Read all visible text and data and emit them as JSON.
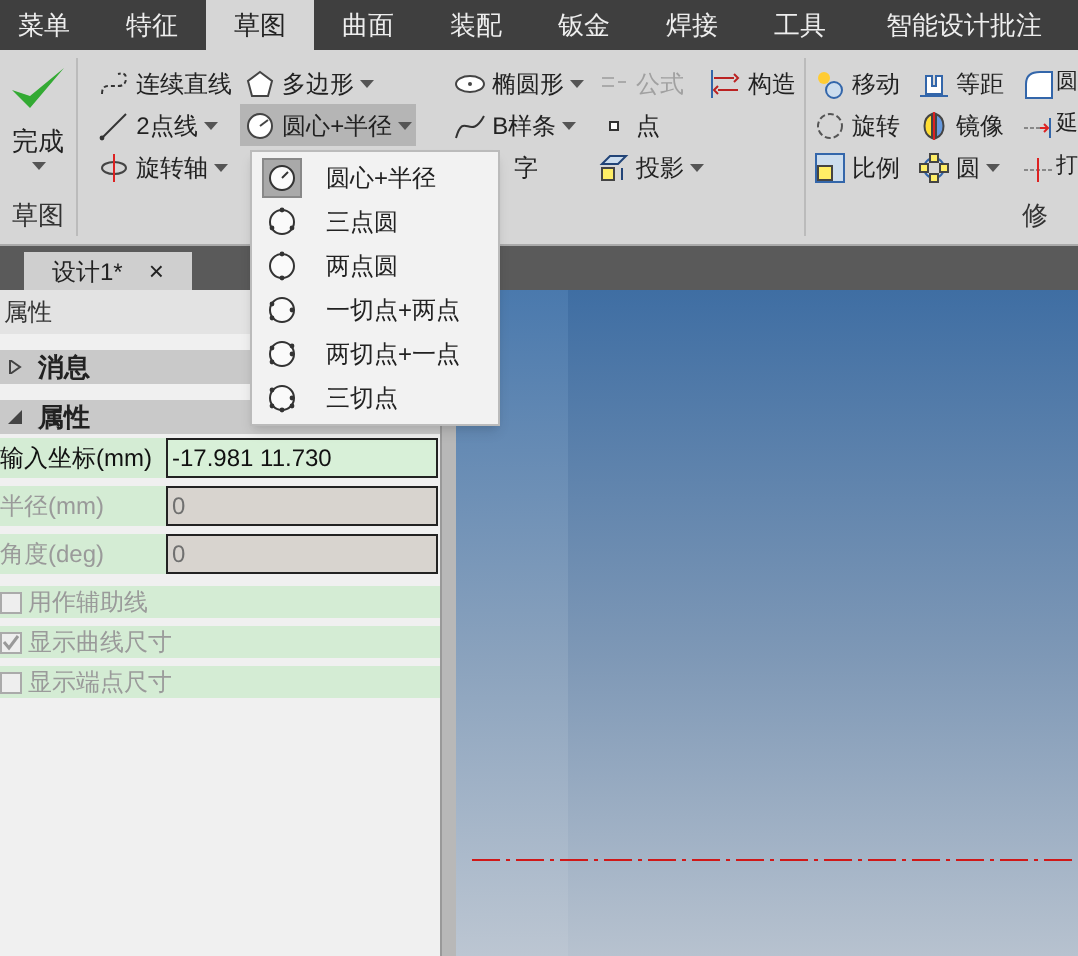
{
  "menu_tabs": [
    {
      "label": "菜单",
      "selected": false
    },
    {
      "label": "特征",
      "selected": false
    },
    {
      "label": "草图",
      "selected": true
    },
    {
      "label": "曲面",
      "selected": false
    },
    {
      "label": "装配",
      "selected": false
    },
    {
      "label": "钣金",
      "selected": false
    },
    {
      "label": "焊接",
      "selected": false
    },
    {
      "label": "工具",
      "selected": false
    },
    {
      "label": "智能设计批注",
      "selected": false
    }
  ],
  "ribbon": {
    "finish_button": {
      "label": "完成"
    },
    "sketch_group": {
      "label": "草图",
      "columns": [
        [
          {
            "label": "连续直线",
            "dropdown": false,
            "disabled": false,
            "active": false
          },
          {
            "label": "2点线",
            "dropdown": true,
            "disabled": false,
            "active": false
          },
          {
            "label": "旋转轴",
            "dropdown": true,
            "disabled": false,
            "active": false
          }
        ],
        [
          {
            "label": "多边形",
            "dropdown": true,
            "disabled": false,
            "active": false
          },
          {
            "label": "圆心+半径",
            "dropdown": true,
            "disabled": false,
            "active": true
          }
        ],
        [
          {
            "label": "椭圆形",
            "dropdown": true,
            "disabled": false,
            "active": false
          },
          {
            "label": "B样条",
            "dropdown": true,
            "disabled": false,
            "active": false
          },
          {
            "label": "字",
            "dropdown": false,
            "disabled": false,
            "active": false
          }
        ],
        [
          {
            "label": "公式",
            "dropdown": false,
            "disabled": true,
            "active": false
          },
          {
            "label": "点",
            "dropdown": false,
            "disabled": false,
            "active": false
          },
          {
            "label": "投影",
            "dropdown": true,
            "disabled": false,
            "active": false
          }
        ],
        [
          {
            "label": "构造",
            "dropdown": false,
            "disabled": false,
            "active": false
          }
        ]
      ]
    },
    "modify_group": {
      "label": "修",
      "columns": [
        [
          {
            "label": "移动",
            "dropdown": false,
            "disabled": false,
            "active": false
          },
          {
            "label": "旋转",
            "dropdown": false,
            "disabled": false,
            "active": false
          },
          {
            "label": "比例",
            "dropdown": false,
            "disabled": false,
            "active": false
          }
        ],
        [
          {
            "label": "等距",
            "dropdown": false,
            "disabled": false,
            "active": false
          },
          {
            "label": "镜像",
            "dropdown": false,
            "disabled": false,
            "active": false
          },
          {
            "label": "圆",
            "dropdown": true,
            "disabled": false,
            "active": false
          }
        ],
        [
          {
            "label": "圆",
            "disabled": false,
            "active": false
          },
          {
            "label": "延",
            "disabled": false,
            "active": false
          },
          {
            "label": "打",
            "disabled": false,
            "active": false
          }
        ]
      ]
    }
  },
  "dropdown_menu": {
    "items": [
      {
        "label": "圆心+半径",
        "selected": true
      },
      {
        "label": "三点圆",
        "selected": false
      },
      {
        "label": "两点圆",
        "selected": false
      },
      {
        "label": "一切点+两点",
        "selected": false
      },
      {
        "label": "两切点+一点",
        "selected": false
      },
      {
        "label": "三切点",
        "selected": false
      }
    ]
  },
  "document_tab": {
    "title": "设计1*",
    "close": "×"
  },
  "panel": {
    "title": "属性",
    "sections": [
      {
        "label": "消息",
        "expanded": false
      },
      {
        "label": "属性",
        "expanded": true
      }
    ],
    "fields": [
      {
        "label": "输入坐标(mm)",
        "value": "-17.981 11.730",
        "disabled": false
      },
      {
        "label": "半径(mm)",
        "value": "0",
        "disabled": true
      },
      {
        "label": "角度(deg)",
        "value": "0",
        "disabled": true
      }
    ],
    "checkboxes": [
      {
        "label": "用作辅助线",
        "checked": false,
        "disabled": true
      },
      {
        "label": "显示曲线尺寸",
        "checked": true,
        "disabled": true
      },
      {
        "label": "显示端点尺寸",
        "checked": false,
        "disabled": true
      }
    ]
  }
}
